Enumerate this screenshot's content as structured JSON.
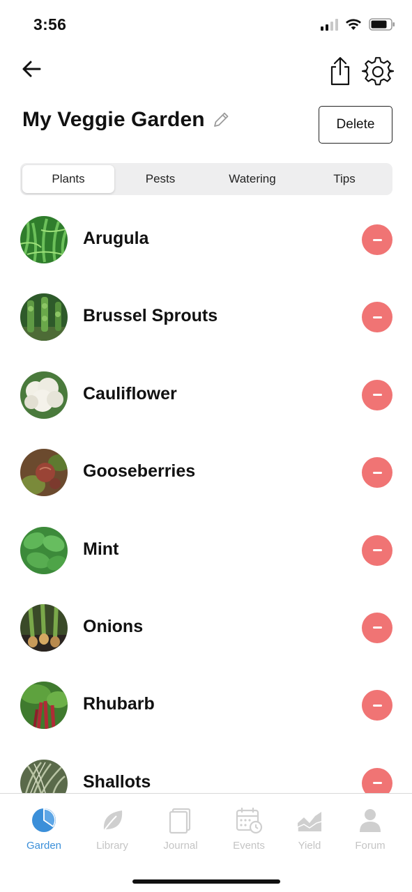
{
  "status_bar": {
    "time": "3:56"
  },
  "header": {
    "title": "My Veggie Garden",
    "delete_label": "Delete"
  },
  "tabs": [
    {
      "label": "Plants",
      "active": true
    },
    {
      "label": "Pests",
      "active": false
    },
    {
      "label": "Watering",
      "active": false
    },
    {
      "label": "Tips",
      "active": false
    }
  ],
  "plants": [
    {
      "name": "Arugula",
      "thumb_color": "#3f9a3a"
    },
    {
      "name": "Brussel Sprouts",
      "thumb_color": "#3a6e34"
    },
    {
      "name": "Cauliflower",
      "thumb_color": "#e9e7dc"
    },
    {
      "name": "Gooseberries",
      "thumb_color": "#8a4b3a"
    },
    {
      "name": "Mint",
      "thumb_color": "#4fa84a"
    },
    {
      "name": "Onions",
      "thumb_color": "#4d6b2d"
    },
    {
      "name": "Rhubarb",
      "thumb_color": "#a8323a"
    },
    {
      "name": "Shallots",
      "thumb_color": "#7d8a6a"
    }
  ],
  "tabbar": [
    {
      "label": "Garden",
      "icon": "pie-chart-icon",
      "active": true
    },
    {
      "label": "Library",
      "icon": "leaf-icon",
      "active": false
    },
    {
      "label": "Journal",
      "icon": "journal-icon",
      "active": false
    },
    {
      "label": "Events",
      "icon": "calendar-clock-icon",
      "active": false
    },
    {
      "label": "Yield",
      "icon": "area-chart-icon",
      "active": false
    },
    {
      "label": "Forum",
      "icon": "person-icon",
      "active": false
    }
  ],
  "colors": {
    "accent": "#3b8fd9",
    "remove": "#f07474",
    "inactive": "#c4c4c4"
  }
}
